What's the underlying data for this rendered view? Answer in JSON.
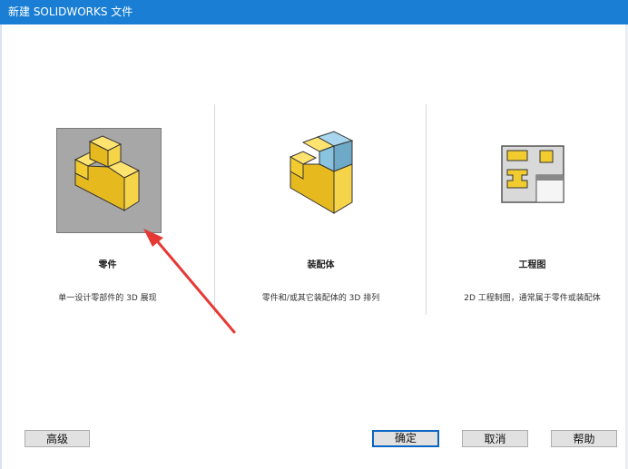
{
  "window": {
    "title": "新建 SOLIDWORKS 文件"
  },
  "panels": [
    {
      "label": "零件",
      "description": "单一设计零部件的 3D 展现",
      "icon": "part-icon",
      "selected": true
    },
    {
      "label": "装配体",
      "description": "零件和/或其它装配体的 3D 排列",
      "icon": "assembly-icon",
      "selected": false
    },
    {
      "label": "工程图",
      "description": "2D 工程制图，通常属于零件或装配体",
      "icon": "drawing-icon",
      "selected": false
    }
  ],
  "buttons": {
    "advanced": "高级",
    "ok": "确定",
    "cancel": "取消",
    "help": "帮助"
  },
  "annotation": {
    "arrow_color": "#e53935"
  },
  "colors": {
    "title_bar": "#1a7fd4",
    "part_yellow": "#f2cc2e",
    "assembly_blue": "#8ac3e0"
  }
}
